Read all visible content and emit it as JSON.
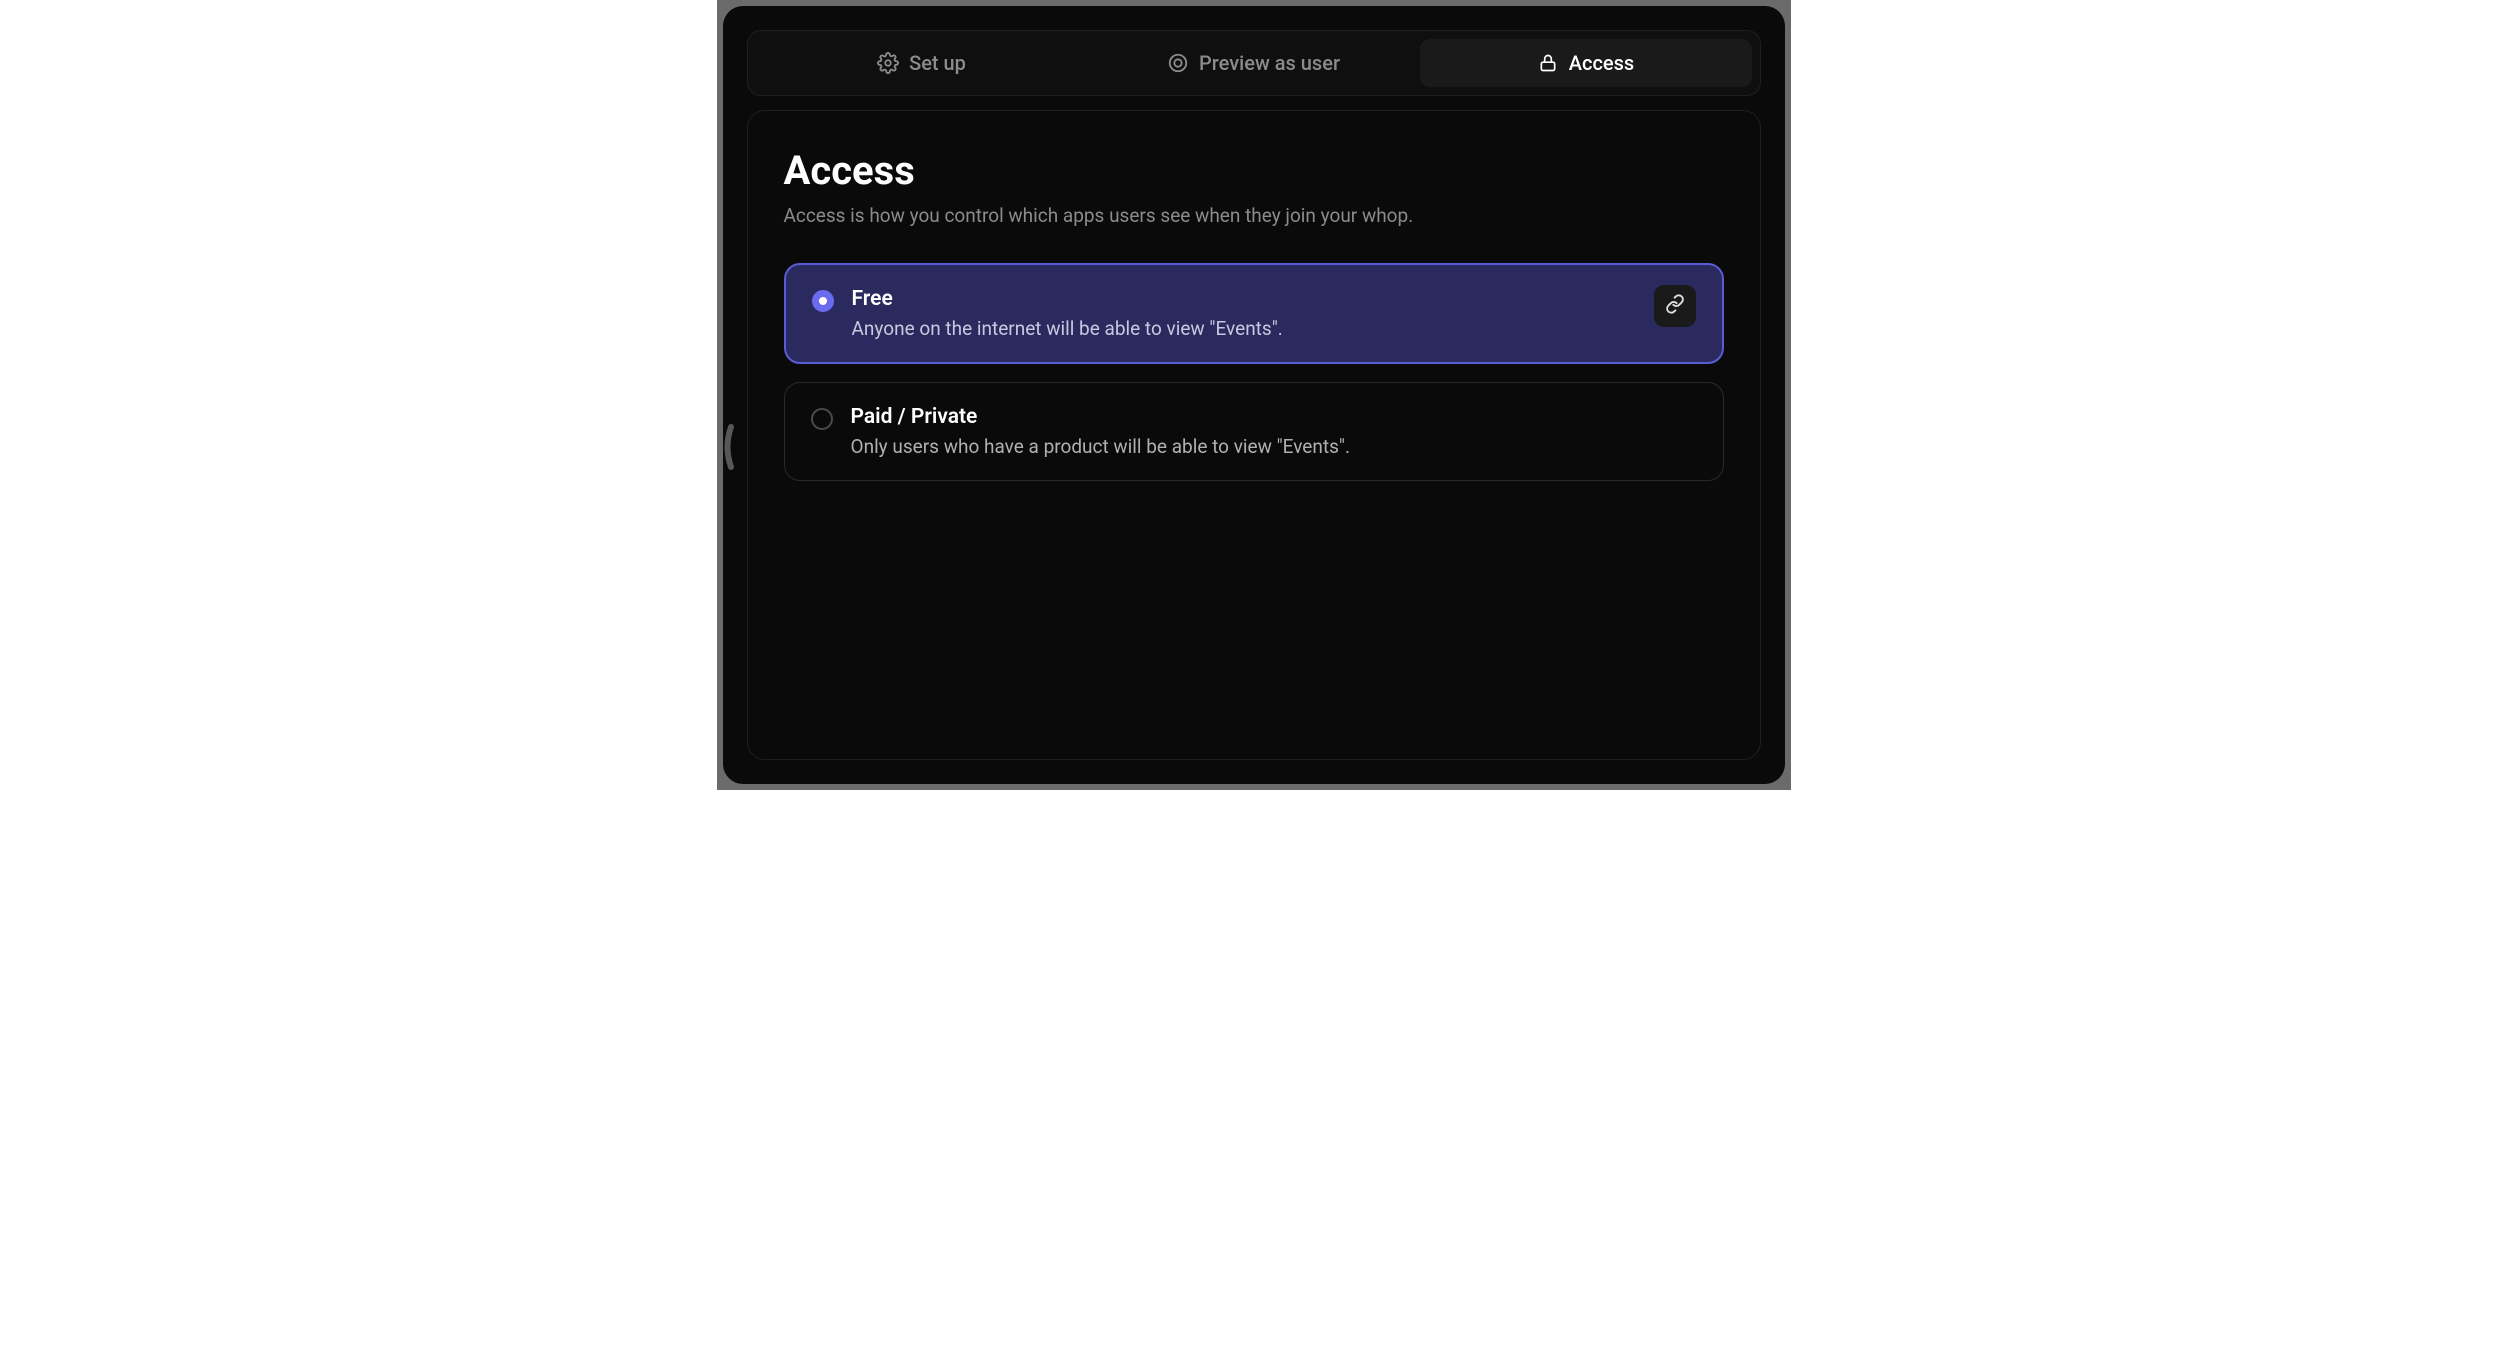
{
  "tabs": [
    {
      "label": "Set up",
      "icon": "gear-icon"
    },
    {
      "label": "Preview as user",
      "icon": "eye-icon"
    },
    {
      "label": "Access",
      "icon": "lock-icon"
    }
  ],
  "activeTab": 2,
  "page": {
    "title": "Access",
    "subtitle": "Access is how you control which apps users see when they join your whop."
  },
  "options": [
    {
      "title": "Free",
      "description": "Anyone on the internet will be able to view \"Events\".",
      "selected": true,
      "hasLink": true
    },
    {
      "title": "Paid / Private",
      "description": "Only users who have a product will be able to view \"Events\".",
      "selected": false,
      "hasLink": false
    }
  ]
}
